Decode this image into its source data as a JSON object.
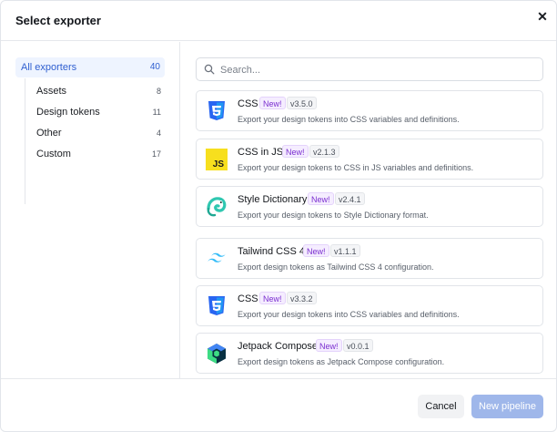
{
  "dialog": {
    "title": "Select exporter",
    "close_icon": "close-icon"
  },
  "sidebar": {
    "all": {
      "label": "All exporters",
      "count": "40"
    },
    "items": [
      {
        "label": "Assets",
        "count": "8"
      },
      {
        "label": "Design tokens",
        "count": "11"
      },
      {
        "label": "Other",
        "count": "4"
      },
      {
        "label": "Custom",
        "count": "17"
      }
    ]
  },
  "search": {
    "placeholder": "Search...",
    "value": "",
    "icon": "search-icon"
  },
  "exporters": [
    {
      "name": "CSS",
      "badge": "New!",
      "version": "v3.5.0",
      "description": "Export your design tokens into CSS variables and definitions.",
      "icon": "css3-logo-icon"
    },
    {
      "name": "CSS in JS",
      "badge": "New!",
      "version": "v2.1.3",
      "description": "Export your design tokens to CSS in JS variables and definitions.",
      "icon": "javascript-logo-icon"
    },
    {
      "name": "Style Dictionary",
      "badge": "New!",
      "version": "v2.4.1",
      "description": "Export your design tokens to Style Dictionary format.",
      "icon": "chameleon-logo-icon"
    },
    {
      "name": "Tailwind CSS 4",
      "badge": "New!",
      "version": "v1.1.1",
      "description": "Export design tokens as Tailwind CSS 4 configuration.",
      "icon": "tailwind-logo-icon"
    },
    {
      "name": "CSS",
      "badge": "New!",
      "version": "v3.3.2",
      "description": "Export your design tokens into CSS variables and definitions.",
      "icon": "css3-logo-icon"
    },
    {
      "name": "Jetpack Compose",
      "badge": "New!",
      "version": "v0.0.1",
      "description": "Export design tokens as Jetpack Compose configuration.",
      "icon": "jetpack-compose-logo-icon"
    }
  ],
  "footer": {
    "cancel_label": "Cancel",
    "primary_label": "New pipeline"
  },
  "colors": {
    "accent": "#2f5fd0",
    "primary_disabled": "#9fb7ea",
    "badge_new": "#7b2fd0",
    "css_blue": "#2965f1",
    "js_yellow": "#f7df1e",
    "tailwind_teal": "#38bdf8"
  }
}
